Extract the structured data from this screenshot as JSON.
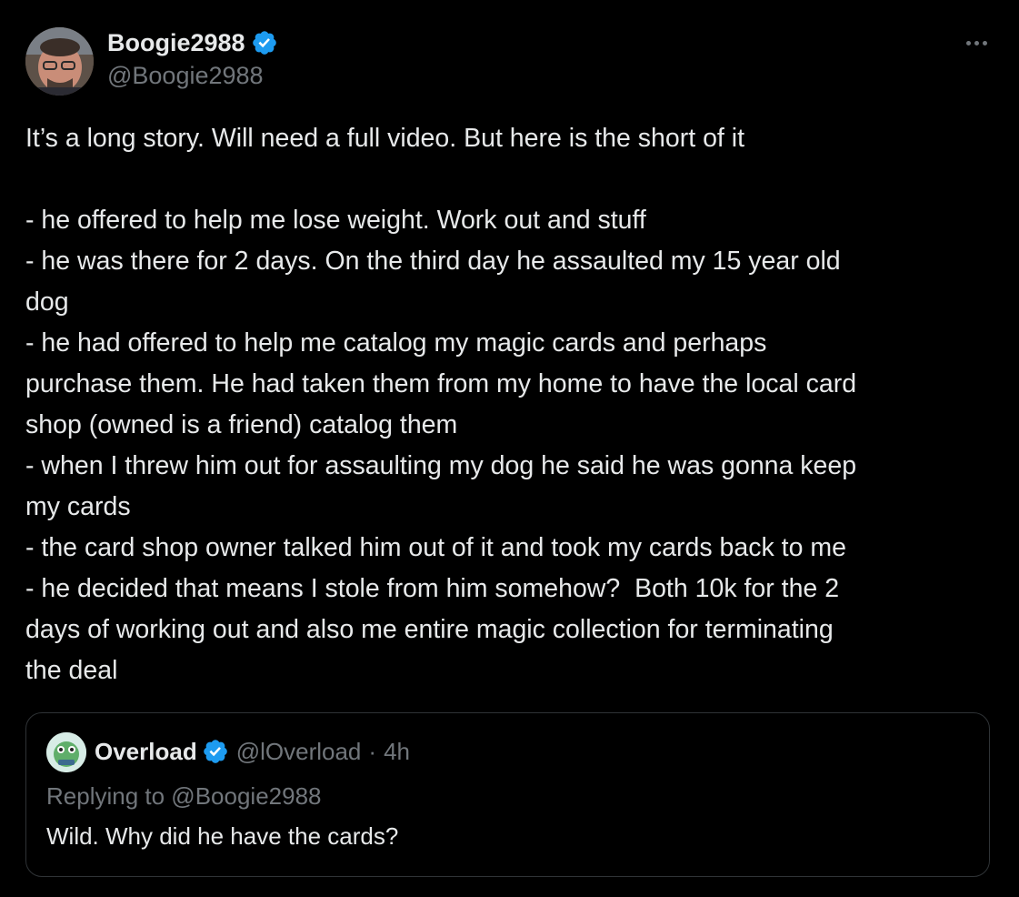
{
  "author": {
    "display_name": "Boogie2988",
    "handle": "@Boogie2988",
    "verified": true,
    "avatar_icon": "profile-photo"
  },
  "menu": {
    "icon": "more-options-icon"
  },
  "tweet": {
    "lines": [
      "It’s a long story. Will need a full video. But here is the short of it",
      "",
      "- he offered to help me lose weight. Work out and stuff",
      "- he was there for 2 days. On the third day he assaulted my 15 year old",
      "dog",
      "- he had offered to help me catalog my magic cards and perhaps",
      "purchase them. He had taken them from my home to have the local card",
      "shop (owned is a friend) catalog them",
      "- when I threw him out for assaulting my dog he said he was gonna keep",
      "my cards",
      "- the card shop owner talked him out of it and took my cards back to me",
      "- he decided that means I stole from him somehow?  Both 10k for the 2",
      "days of working out and also me entire magic collection for terminating",
      "the deal"
    ]
  },
  "quoted": {
    "display_name": "Overload",
    "handle": "@lOverload",
    "separator": "·",
    "time": "4h",
    "verified": true,
    "replying_to": "Replying to @Boogie2988",
    "text": "Wild. Why did he have the cards?"
  },
  "colors": {
    "background": "#000000",
    "text": "#e7e9ea",
    "secondary": "#71767b",
    "verified_badge": "#1d9bf0",
    "border": "#2f3336"
  }
}
